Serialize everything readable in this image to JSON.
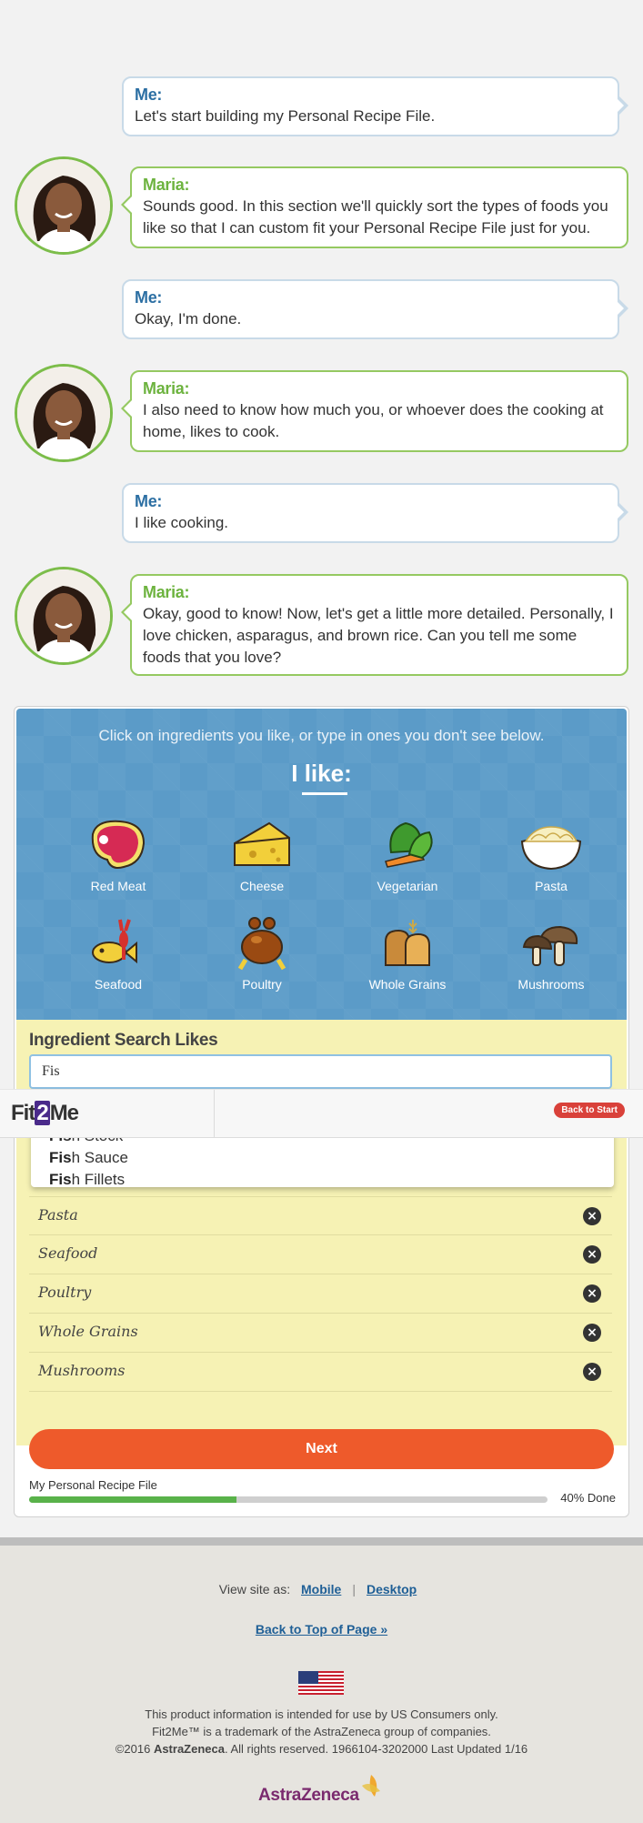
{
  "conversation": [
    {
      "speaker": "Me:",
      "text": "Let's start building my Personal Recipe File."
    },
    {
      "speaker": "Maria:",
      "text": "Sounds good. In this section we'll quickly sort the types of foods you like so that I can custom fit your Personal Recipe File just for you."
    },
    {
      "speaker": "Me:",
      "text": "Okay, I'm done."
    },
    {
      "speaker": "Maria:",
      "text": "I also need to know how much you, or whoever does the cooking at home, likes to cook."
    },
    {
      "speaker": "Me:",
      "text": "I like cooking."
    },
    {
      "speaker": "Maria:",
      "text": "Okay, good to know! Now, let's get a little more detailed. Personally, I love chicken, asparagus, and brown rice. Can you tell me some foods that you love?"
    }
  ],
  "ingredients_panel": {
    "instruction": "Click on ingredients you like, or type in ones you don't see below.",
    "heading": "I like:",
    "categories": [
      {
        "label": "Red Meat",
        "icon": "steak-icon"
      },
      {
        "label": "Cheese",
        "icon": "cheese-icon"
      },
      {
        "label": "Vegetarian",
        "icon": "vegetables-icon"
      },
      {
        "label": "Pasta",
        "icon": "pasta-bowl-icon"
      },
      {
        "label": "Seafood",
        "icon": "seafood-icon"
      },
      {
        "label": "Poultry",
        "icon": "turkey-icon"
      },
      {
        "label": "Whole Grains",
        "icon": "bread-icon"
      },
      {
        "label": "Mushrooms",
        "icon": "mushroom-icon"
      }
    ]
  },
  "search": {
    "title": "Ingredient Search Likes",
    "value": "Fis",
    "suggestions": [
      {
        "match": "Fis",
        "rest": "h Stock"
      },
      {
        "match": "Fis",
        "rest": "h Sauce"
      },
      {
        "match": "Fis",
        "rest": "h Fillets"
      }
    ],
    "likes": [
      "Pasta",
      "Seafood",
      "Poultry",
      "Whole Grains",
      "Mushrooms"
    ]
  },
  "next_label": "Next",
  "progress": {
    "label": "My Personal Recipe File",
    "percent": 40,
    "percent_text": "40% Done"
  },
  "header": {
    "logo_left": "Fit",
    "logo_mid": "2",
    "logo_right": "Me",
    "back_to_start": "Back to Start"
  },
  "footer": {
    "view_site_as": "View site as:",
    "mobile": "Mobile",
    "separator": "|",
    "desktop": "Desktop",
    "back_to_top": "Back to Top of Page »",
    "legal_1": "This product information is intended for use by US Consumers only.",
    "legal_2": "Fit2Me™ is a trademark of the AstraZeneca group of companies.",
    "legal_3_pre": "©2016 ",
    "legal_3_brand": "AstraZeneca",
    "legal_3_post": ". All rights reserved. 1966104-3202000 Last Updated 1/16",
    "brand": "AstraZeneca"
  },
  "colors": {
    "me_name": "#2c6fa3",
    "maria_name": "#6db33f",
    "panel_blue": "#5b9bc8",
    "panel_yellow": "#f6f2b4",
    "next_button": "#ee5a2b",
    "progress_fill": "#59b24a"
  }
}
